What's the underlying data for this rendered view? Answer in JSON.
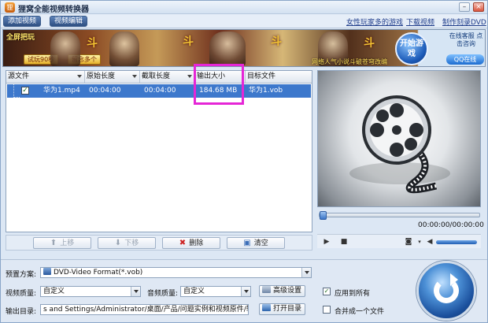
{
  "window": {
    "title": "狸窝全能视频转换器",
    "icon_label": "狸"
  },
  "menu": {
    "tabs": [
      "添加视频",
      "视频编辑"
    ],
    "links": [
      "女性玩家多的游戏",
      "下载视频",
      "制作刻录DVD"
    ]
  },
  "banner": {
    "fullscreen_label": "全屏把玩",
    "try_label": "试玩90秒",
    "leave_label": "留念多个",
    "glyph": "斗",
    "footer_text": "网络人气小说斗破苍穹改编",
    "start_label": "开始游戏",
    "service_label": "在线客服 点击咨询",
    "qq_label": "QQ在线"
  },
  "table": {
    "columns": [
      "源文件",
      "原始长度",
      "截取长度",
      "输出大小",
      "目标文件"
    ],
    "rows": [
      {
        "checked": true,
        "source": "华为1.mp4",
        "orig_length": "00:04:00",
        "clip_length": "00:04:00",
        "output_size": "184.68 MB",
        "target": "华为1.vob"
      }
    ]
  },
  "actions": {
    "up": "上移",
    "down": "下移",
    "delete": "删除",
    "clear": "清空"
  },
  "player": {
    "timecode": "00:00:00/00:00:00",
    "seek_progress": 0,
    "volume": 1
  },
  "settings": {
    "preset_label": "预置方案:",
    "preset_value": "DVD-Video Format(*.vob)",
    "video_quality_label": "视频质量:",
    "video_quality_value": "自定义",
    "audio_quality_label": "音频质量:",
    "audio_quality_value": "自定义",
    "advanced_label": "高级设置",
    "apply_all_label": "应用到所有",
    "apply_all_checked": true,
    "output_dir_label": "输出目录:",
    "output_dir_value": "s and Settings/Administrator/桌面/产品/问题实例和视频原件/转换",
    "open_dir_label": "打开目录",
    "merge_label": "合并成一个文件",
    "merge_checked": false
  },
  "colors": {
    "selection": "#3d78cc",
    "highlight_box": "#e526d6",
    "accent": "#2e4f82"
  }
}
